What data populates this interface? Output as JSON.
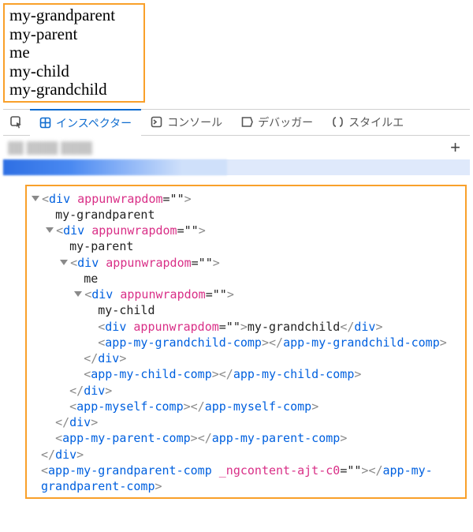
{
  "output": {
    "lines": [
      "my-grandparent",
      "my-parent",
      "me",
      "my-child",
      "my-grandchild"
    ]
  },
  "devtools": {
    "tabs": {
      "inspector": "インスペクター",
      "console": "コンソール",
      "debugger": "デバッガー",
      "style_editor": "スタイルエ"
    },
    "add_tab_tooltip": "+"
  },
  "dom": {
    "lines": [
      {
        "indent": 0,
        "twisty": true,
        "pad": false,
        "tokens": [
          [
            "angle",
            "<"
          ],
          [
            "tag",
            "div"
          ],
          [
            "txt",
            " "
          ],
          [
            "attr",
            "appunwrapdom"
          ],
          [
            "txt",
            "=\"\""
          ],
          [
            "angle",
            ">"
          ]
        ]
      },
      {
        "indent": 1,
        "twisty": false,
        "pad": true,
        "tokens": [
          [
            "txt",
            "my-grandparent"
          ]
        ]
      },
      {
        "indent": 1,
        "twisty": true,
        "pad": false,
        "tokens": [
          [
            "angle",
            "<"
          ],
          [
            "tag",
            "div"
          ],
          [
            "txt",
            " "
          ],
          [
            "attr",
            "appunwrapdom"
          ],
          [
            "txt",
            "=\"\""
          ],
          [
            "angle",
            ">"
          ]
        ]
      },
      {
        "indent": 2,
        "twisty": false,
        "pad": true,
        "tokens": [
          [
            "txt",
            "my-parent"
          ]
        ]
      },
      {
        "indent": 2,
        "twisty": true,
        "pad": false,
        "tokens": [
          [
            "angle",
            "<"
          ],
          [
            "tag",
            "div"
          ],
          [
            "txt",
            " "
          ],
          [
            "attr",
            "appunwrapdom"
          ],
          [
            "txt",
            "=\"\""
          ],
          [
            "angle",
            ">"
          ]
        ]
      },
      {
        "indent": 3,
        "twisty": false,
        "pad": true,
        "tokens": [
          [
            "txt",
            "me"
          ]
        ]
      },
      {
        "indent": 3,
        "twisty": true,
        "pad": false,
        "tokens": [
          [
            "angle",
            "<"
          ],
          [
            "tag",
            "div"
          ],
          [
            "txt",
            " "
          ],
          [
            "attr",
            "appunwrapdom"
          ],
          [
            "txt",
            "=\"\""
          ],
          [
            "angle",
            ">"
          ]
        ]
      },
      {
        "indent": 4,
        "twisty": false,
        "pad": true,
        "tokens": [
          [
            "txt",
            "my-child"
          ]
        ]
      },
      {
        "indent": 4,
        "twisty": false,
        "pad": true,
        "tokens": [
          [
            "angle",
            "<"
          ],
          [
            "tag",
            "div"
          ],
          [
            "txt",
            " "
          ],
          [
            "attr",
            "appunwrapdom"
          ],
          [
            "txt",
            "=\"\""
          ],
          [
            "angle",
            ">"
          ],
          [
            "txt",
            "my-grandchild"
          ],
          [
            "angle",
            "</"
          ],
          [
            "tag",
            "div"
          ],
          [
            "angle",
            ">"
          ]
        ]
      },
      {
        "indent": 4,
        "twisty": false,
        "pad": true,
        "tokens": [
          [
            "angle",
            "<"
          ],
          [
            "tag",
            "app-my-grandchild-comp"
          ],
          [
            "angle",
            ">"
          ],
          [
            "angle",
            "</"
          ],
          [
            "tag",
            "app-my-grandchild-comp"
          ],
          [
            "angle",
            ">"
          ]
        ]
      },
      {
        "indent": 3,
        "twisty": false,
        "pad": true,
        "tokens": [
          [
            "angle",
            "</"
          ],
          [
            "tag",
            "div"
          ],
          [
            "angle",
            ">"
          ]
        ]
      },
      {
        "indent": 3,
        "twisty": false,
        "pad": true,
        "tokens": [
          [
            "angle",
            "<"
          ],
          [
            "tag",
            "app-my-child-comp"
          ],
          [
            "angle",
            ">"
          ],
          [
            "angle",
            "</"
          ],
          [
            "tag",
            "app-my-child-comp"
          ],
          [
            "angle",
            ">"
          ]
        ]
      },
      {
        "indent": 2,
        "twisty": false,
        "pad": true,
        "tokens": [
          [
            "angle",
            "</"
          ],
          [
            "tag",
            "div"
          ],
          [
            "angle",
            ">"
          ]
        ]
      },
      {
        "indent": 2,
        "twisty": false,
        "pad": true,
        "tokens": [
          [
            "angle",
            "<"
          ],
          [
            "tag",
            "app-myself-comp"
          ],
          [
            "angle",
            ">"
          ],
          [
            "angle",
            "</"
          ],
          [
            "tag",
            "app-myself-comp"
          ],
          [
            "angle",
            ">"
          ]
        ]
      },
      {
        "indent": 1,
        "twisty": false,
        "pad": true,
        "tokens": [
          [
            "angle",
            "</"
          ],
          [
            "tag",
            "div"
          ],
          [
            "angle",
            ">"
          ]
        ]
      },
      {
        "indent": 1,
        "twisty": false,
        "pad": true,
        "tokens": [
          [
            "angle",
            "<"
          ],
          [
            "tag",
            "app-my-parent-comp"
          ],
          [
            "angle",
            ">"
          ],
          [
            "angle",
            "</"
          ],
          [
            "tag",
            "app-my-parent-comp"
          ],
          [
            "angle",
            ">"
          ]
        ]
      },
      {
        "indent": 0,
        "twisty": false,
        "pad": true,
        "tokens": [
          [
            "angle",
            "</"
          ],
          [
            "tag",
            "div"
          ],
          [
            "angle",
            ">"
          ]
        ]
      },
      {
        "indent": 0,
        "twisty": false,
        "pad": true,
        "tokens": [
          [
            "angle",
            "<"
          ],
          [
            "tag",
            "app-my-grandparent-comp"
          ],
          [
            "txt",
            " "
          ],
          [
            "attr",
            "_ngcontent-ajt-c0"
          ],
          [
            "txt",
            "=\"\""
          ],
          [
            "angle",
            ">"
          ],
          [
            "angle",
            "</"
          ],
          [
            "tag",
            "app-my-"
          ]
        ]
      },
      {
        "indent": 0,
        "twisty": false,
        "pad": true,
        "tokens": [
          [
            "tag",
            "grandparent-comp"
          ],
          [
            "angle",
            ">"
          ]
        ]
      }
    ]
  }
}
